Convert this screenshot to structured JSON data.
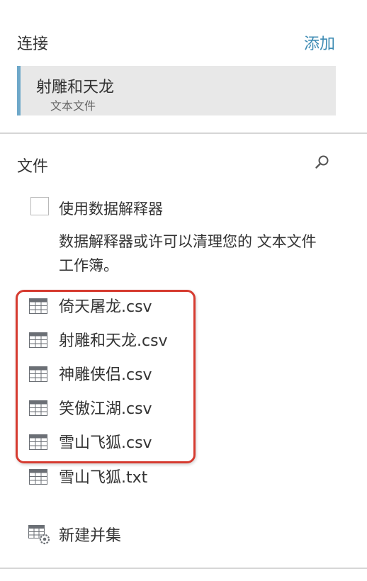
{
  "connections": {
    "title": "连接",
    "add_label": "添加",
    "items": [
      {
        "name": "射雕和天龙",
        "type": "文本文件"
      }
    ]
  },
  "files": {
    "title": "文件",
    "search_icon": "search-icon",
    "interpreter": {
      "label": "使用数据解释器",
      "checked": false,
      "description": "数据解释器或许可以清理您的 文本文件 工作簿。"
    },
    "items": [
      {
        "name": "倚天屠龙.csv",
        "icon": "table-icon"
      },
      {
        "name": "射雕和天龙.csv",
        "icon": "table-icon"
      },
      {
        "name": "神雕侠侣.csv",
        "icon": "table-icon"
      },
      {
        "name": "笑傲江湖.csv",
        "icon": "table-icon"
      },
      {
        "name": "雪山飞狐.csv",
        "icon": "table-icon"
      },
      {
        "name": "雪山飞狐.txt",
        "icon": "table-icon"
      }
    ],
    "new_union_label": "新建并集"
  },
  "colors": {
    "accent": "#3d8bb3",
    "highlight": "#d63b30",
    "card_bg": "#e8e8e8",
    "card_border": "#6ea8c9"
  }
}
